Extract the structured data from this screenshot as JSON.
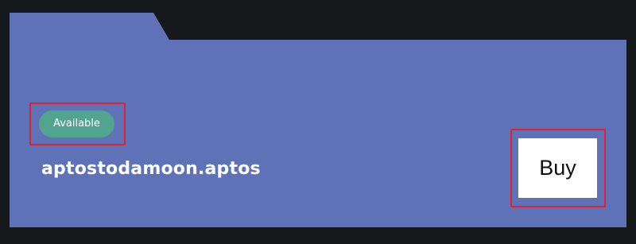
{
  "listing": {
    "status": "Available",
    "domain": "aptostodamoon.aptos",
    "buy_label": "Buy"
  },
  "colors": {
    "background": "#16191b",
    "card": "#5f72b8",
    "available_badge": "#51a48d",
    "highlight": "#e2202e",
    "button": "#ffffff"
  }
}
